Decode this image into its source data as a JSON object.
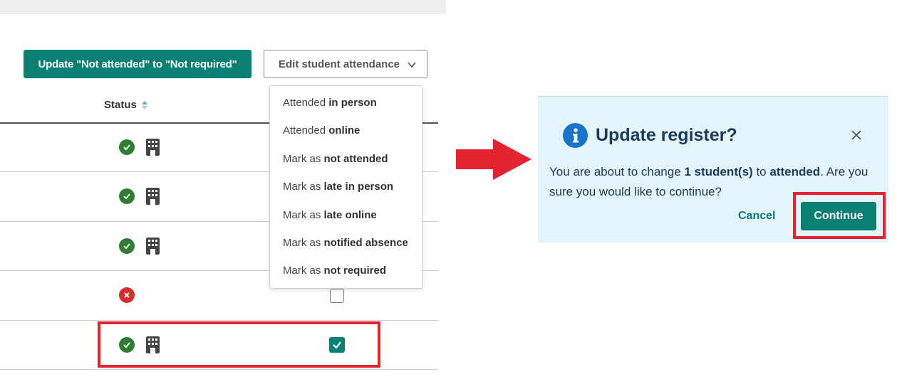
{
  "toolbar": {
    "update_button": "Update \"Not attended\" to \"Not required\"",
    "edit_dropdown": "Edit student attendance"
  },
  "table": {
    "status_header": "Status",
    "rows": [
      {
        "status": "attended",
        "mode": "in-person",
        "checkbox": "hidden"
      },
      {
        "status": "attended",
        "mode": "in-person",
        "checkbox": "hidden"
      },
      {
        "status": "attended",
        "mode": "in-person",
        "checkbox": "hidden"
      },
      {
        "status": "not-attended",
        "mode": "",
        "checkbox": "unchecked"
      },
      {
        "status": "attended",
        "mode": "in-person",
        "checkbox": "checked"
      }
    ]
  },
  "dropdown": {
    "items": [
      {
        "prefix": "Attended",
        "bold": "in person"
      },
      {
        "prefix": "Attended",
        "bold": "online"
      },
      {
        "prefix": "Mark as",
        "bold": "not attended"
      },
      {
        "prefix": "Mark as",
        "bold": "late in person"
      },
      {
        "prefix": "Mark as",
        "bold": "late online"
      },
      {
        "prefix": "Mark as",
        "bold": "notified absence"
      },
      {
        "prefix": "Mark as",
        "bold": "not required"
      }
    ]
  },
  "dialog": {
    "title": "Update register?",
    "body_part1": "You are about to change ",
    "body_bold1": "1 student(s)",
    "body_part2": " to ",
    "body_bold2": "attended",
    "body_part3": ". Are you sure you would like to continue?",
    "cancel_label": "Cancel",
    "continue_label": "Continue"
  },
  "colors": {
    "accent": "#0a7f73",
    "success": "#2d7d32",
    "error": "#d62d2d",
    "highlight": "#e3232f",
    "dialog_bg": "#e3f4fb",
    "info": "#1a73c8"
  },
  "icons": {
    "attended": "check-circle-icon",
    "not_attended": "x-circle-icon",
    "in_person": "building-icon",
    "sort": "sort-icon",
    "chevron": "chevron-down-icon",
    "info": "info-icon",
    "close": "close-icon",
    "arrow": "right-arrow-icon"
  }
}
